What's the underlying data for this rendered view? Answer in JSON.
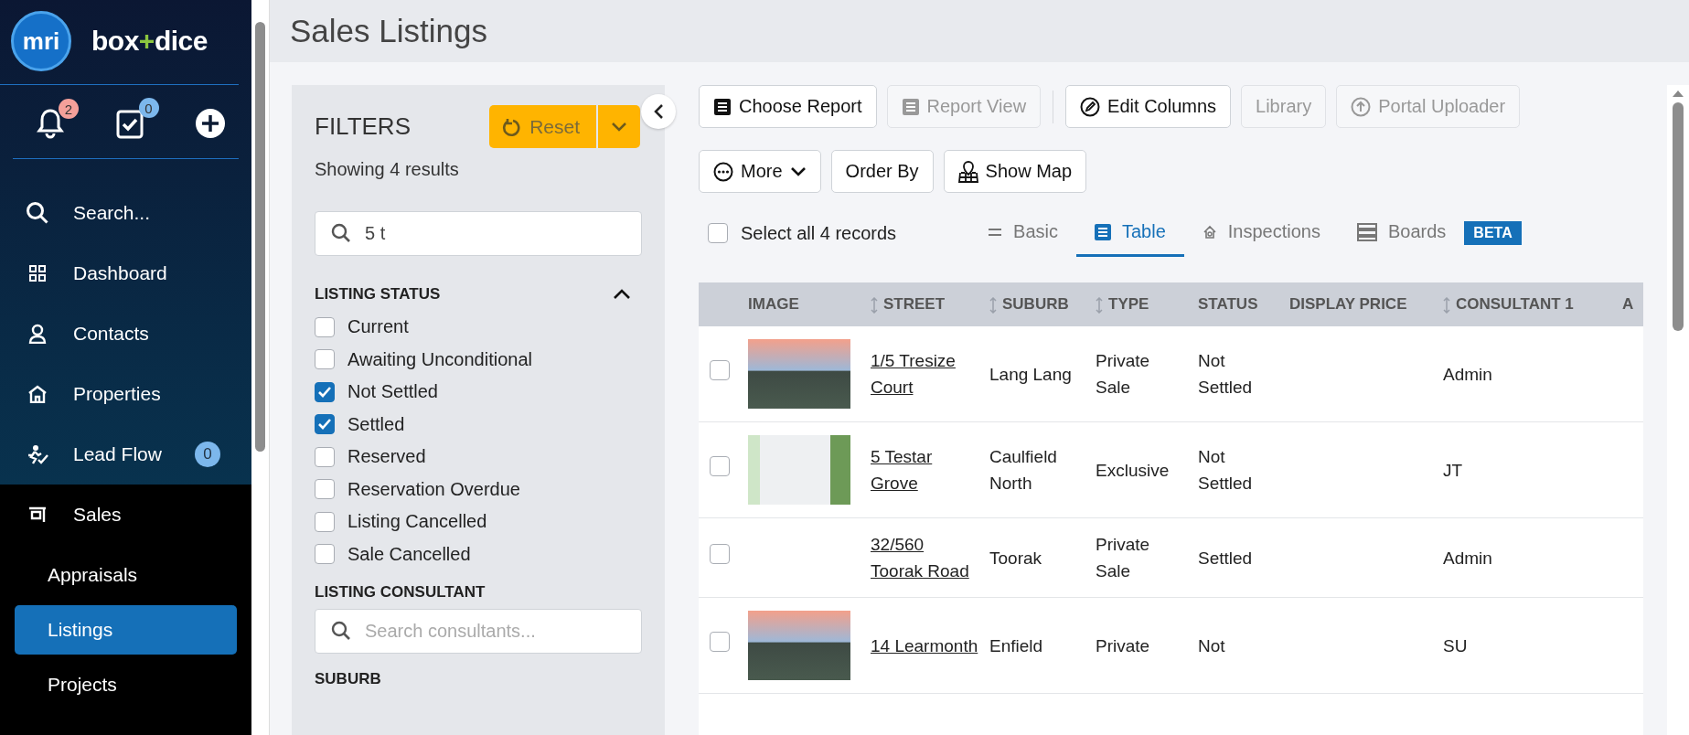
{
  "sidebar": {
    "logo": "mri",
    "brand": [
      {
        "text": "box",
        "accent": false
      },
      {
        "text": "+",
        "accent": true
      },
      {
        "text": "dice",
        "accent": false
      }
    ],
    "quick_actions": [
      {
        "kind": "bell",
        "badge": "2",
        "color": "#f4a09a"
      },
      {
        "kind": "tasks",
        "badge": "0",
        "color": "#7cb7ec"
      },
      {
        "kind": "add"
      }
    ],
    "nav": [
      {
        "kind": "search",
        "label": "Search...",
        "selected": false
      },
      {
        "kind": "dashboard",
        "label": "Dashboard",
        "selected": false
      },
      {
        "kind": "contacts",
        "label": "Contacts",
        "selected": false
      },
      {
        "kind": "properties",
        "label": "Properties",
        "selected": false
      },
      {
        "kind": "leadflow",
        "label": "Lead Flow",
        "badge": "0",
        "selected": false
      },
      {
        "kind": "sales",
        "label": "Sales",
        "selected": false,
        "expanded": true,
        "children": [
          {
            "label": "Appraisals",
            "selected": false
          },
          {
            "label": "Listings",
            "selected": true
          },
          {
            "label": "Projects",
            "selected": false
          }
        ]
      }
    ]
  },
  "page_title": "Sales Listings",
  "filters": {
    "title": "FILTERS",
    "reset": "Reset",
    "summary": "Showing 4 results",
    "search": {
      "value": "5 t"
    },
    "sections": [
      {
        "kind": "checklist",
        "title": "LISTING STATUS",
        "expanded": true,
        "options": [
          {
            "label": "Current",
            "checked": false
          },
          {
            "label": "Awaiting Unconditional",
            "checked": false
          },
          {
            "label": "Not Settled",
            "checked": true
          },
          {
            "label": "Settled",
            "checked": true
          },
          {
            "label": "Reserved",
            "checked": false
          },
          {
            "label": "Reservation Overdue",
            "checked": false
          },
          {
            "label": "Listing Cancelled",
            "checked": false
          },
          {
            "label": "Sale Cancelled",
            "checked": false
          }
        ]
      },
      {
        "kind": "search",
        "title": "LISTING CONSULTANT",
        "placeholder": "Search consultants..."
      },
      {
        "kind": "heading",
        "title": "SUBURB"
      }
    ]
  },
  "toolbar": [
    [
      {
        "kind": "report",
        "label": "Choose Report",
        "disabled": false
      },
      {
        "kind": "report",
        "label": "Report View",
        "disabled": true
      },
      {
        "kind": "separator"
      },
      {
        "kind": "edit",
        "label": "Edit Columns",
        "disabled": false
      },
      {
        "kind": "plain",
        "label": "Library",
        "disabled": true
      },
      {
        "kind": "upload",
        "label": "Portal Uploader",
        "disabled": true
      }
    ],
    [
      {
        "kind": "more",
        "label": "More",
        "disabled": false
      },
      {
        "kind": "plain",
        "label": "Order By",
        "disabled": false
      },
      {
        "kind": "map",
        "label": "Show Map",
        "disabled": false
      }
    ]
  ],
  "select_all": {
    "label": "Select all 4 records",
    "checked": false
  },
  "view_tabs": [
    {
      "kind": "basic",
      "label": "Basic",
      "selected": false
    },
    {
      "kind": "table",
      "label": "Table",
      "selected": true
    },
    {
      "kind": "inspections",
      "label": "Inspections",
      "selected": false
    },
    {
      "kind": "boards",
      "label": "Boards",
      "badge": "BETA",
      "selected": false
    }
  ],
  "table": {
    "columns": [
      {
        "label": "IMAGE",
        "sortable": false
      },
      {
        "label": "STREET",
        "sortable": true
      },
      {
        "label": "SUBURB",
        "sortable": true
      },
      {
        "label": "TYPE",
        "sortable": true
      },
      {
        "label": "STATUS",
        "sortable": false
      },
      {
        "label": "DISPLAY PRICE",
        "sortable": false
      },
      {
        "label": "CONSULTANT 1",
        "sortable": true
      },
      {
        "label": "A",
        "sortable": false
      }
    ],
    "rows": [
      {
        "kind": "exterior",
        "checked": false,
        "street": "1/5 Tresize Court",
        "suburb": "Lang Lang",
        "type": "Private Sale",
        "status": "Not Settled",
        "consultant": "Admin"
      },
      {
        "kind": "interior",
        "checked": false,
        "street": "5 Testar Grove",
        "suburb": "Caulfield North",
        "type": "Exclusive",
        "status": "Not Settled",
        "consultant": "JT"
      },
      {
        "kind": "nophoto",
        "checked": false,
        "street": "32/560 Toorak Road",
        "suburb": "Toorak",
        "type": "Private Sale",
        "status": "Settled",
        "consultant": "Admin"
      },
      {
        "kind": "exterior",
        "checked": false,
        "street": "14 Learmonth",
        "suburb": "Enfield",
        "type": "Private",
        "status": "Not",
        "consultant": "SU"
      }
    ]
  }
}
